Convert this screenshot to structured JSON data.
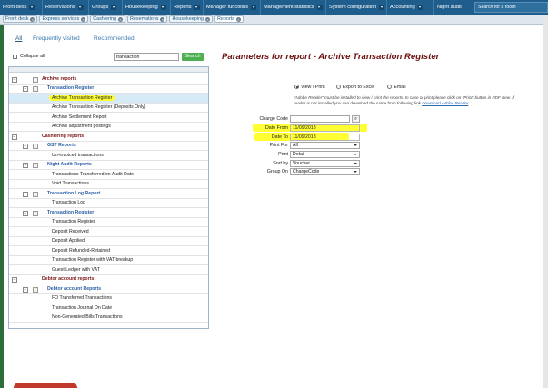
{
  "topnav": {
    "items": [
      "Front desk",
      "Reservations",
      "Groups",
      "Housekeeping",
      "Reports",
      "Manager functions",
      "Management statistics",
      "System configuration",
      "Accounting",
      "Night audit"
    ],
    "search_placeholder": "Search for a room"
  },
  "chips": [
    "Front desk",
    "Express services",
    "Cashiering",
    "Reservations",
    "Housekeeping",
    "Reports"
  ],
  "tabs": [
    "All",
    "Frequently visited",
    "Recommended"
  ],
  "collapse_all": "Collapse all",
  "filter_value": "transaction",
  "search_button": "Search",
  "tree": [
    {
      "level": 1,
      "label": "Archive reports"
    },
    {
      "level": 2,
      "label": "Transaction Register"
    },
    {
      "level": 3,
      "label": "Archive Transaction Register",
      "selected": true
    },
    {
      "level": 3,
      "label": "Archive Transaction Register (Deposits Only)"
    },
    {
      "level": 3,
      "label": "Archive Settlement Report"
    },
    {
      "level": 3,
      "label": "Archive adjustment postings"
    },
    {
      "level": 1,
      "label": "Cashiering reports"
    },
    {
      "level": 2,
      "label": "GST Reports"
    },
    {
      "level": 3,
      "label": "Un-invoiced transactions"
    },
    {
      "level": 2,
      "label": "Night Audit Reports"
    },
    {
      "level": 3,
      "label": "Transactions Transferred on Audit Date"
    },
    {
      "level": 3,
      "label": "Void Transactions"
    },
    {
      "level": 2,
      "label": "Transaction Log Report"
    },
    {
      "level": 3,
      "label": "Transaction Log"
    },
    {
      "level": 2,
      "label": "Transaction Register"
    },
    {
      "level": 3,
      "label": "Transaction Register"
    },
    {
      "level": 3,
      "label": "Deposit Received"
    },
    {
      "level": 3,
      "label": "Deposit Applied"
    },
    {
      "level": 3,
      "label": "Deposit Refunded-Retained"
    },
    {
      "level": 3,
      "label": "Transaction Register with VAT breakup"
    },
    {
      "level": 3,
      "label": "Guest Ledger with VAT"
    },
    {
      "level": 1,
      "label": "Debtor account reports"
    },
    {
      "level": 2,
      "label": "Debtor account Reports"
    },
    {
      "level": 3,
      "label": "FO Transferred Transactions"
    },
    {
      "level": 3,
      "label": "Transaction Journal On Date"
    },
    {
      "level": 3,
      "label": "Non-Generated Bills Transactions"
    }
  ],
  "params": {
    "title": "Parameters for report - Archive Transaction Register",
    "output_options": [
      "View / Print",
      "Export to Excel",
      "Email"
    ],
    "selected_output": "View / Print",
    "note_line1": "\"Adobe Reader\" must be installed to view / print the reports. In case of print please click on \"Print\" button in PDF view. If",
    "note_line2": "reader is not installed you can download the same from following link",
    "note_link": "Download Adobe Reader",
    "fields": [
      {
        "label": "Charge Code",
        "value": "",
        "type": "lookup"
      },
      {
        "label": "Date From",
        "value": "11/09/2018",
        "type": "date"
      },
      {
        "label": "Date To",
        "value": "11/09/2018",
        "type": "date"
      },
      {
        "label": "Print For",
        "value": "All",
        "type": "select"
      },
      {
        "label": "Print",
        "value": "Detail",
        "type": "select"
      },
      {
        "label": "Sort by",
        "value": "Voucher",
        "type": "select"
      },
      {
        "label": "Group On",
        "value": "ChargeCode",
        "type": "select"
      }
    ]
  },
  "colors": {
    "nav_bg": "#1f5d8c",
    "title_color": "#6b1010",
    "highlight": "#ffff33",
    "search_green": "#4caf50"
  }
}
